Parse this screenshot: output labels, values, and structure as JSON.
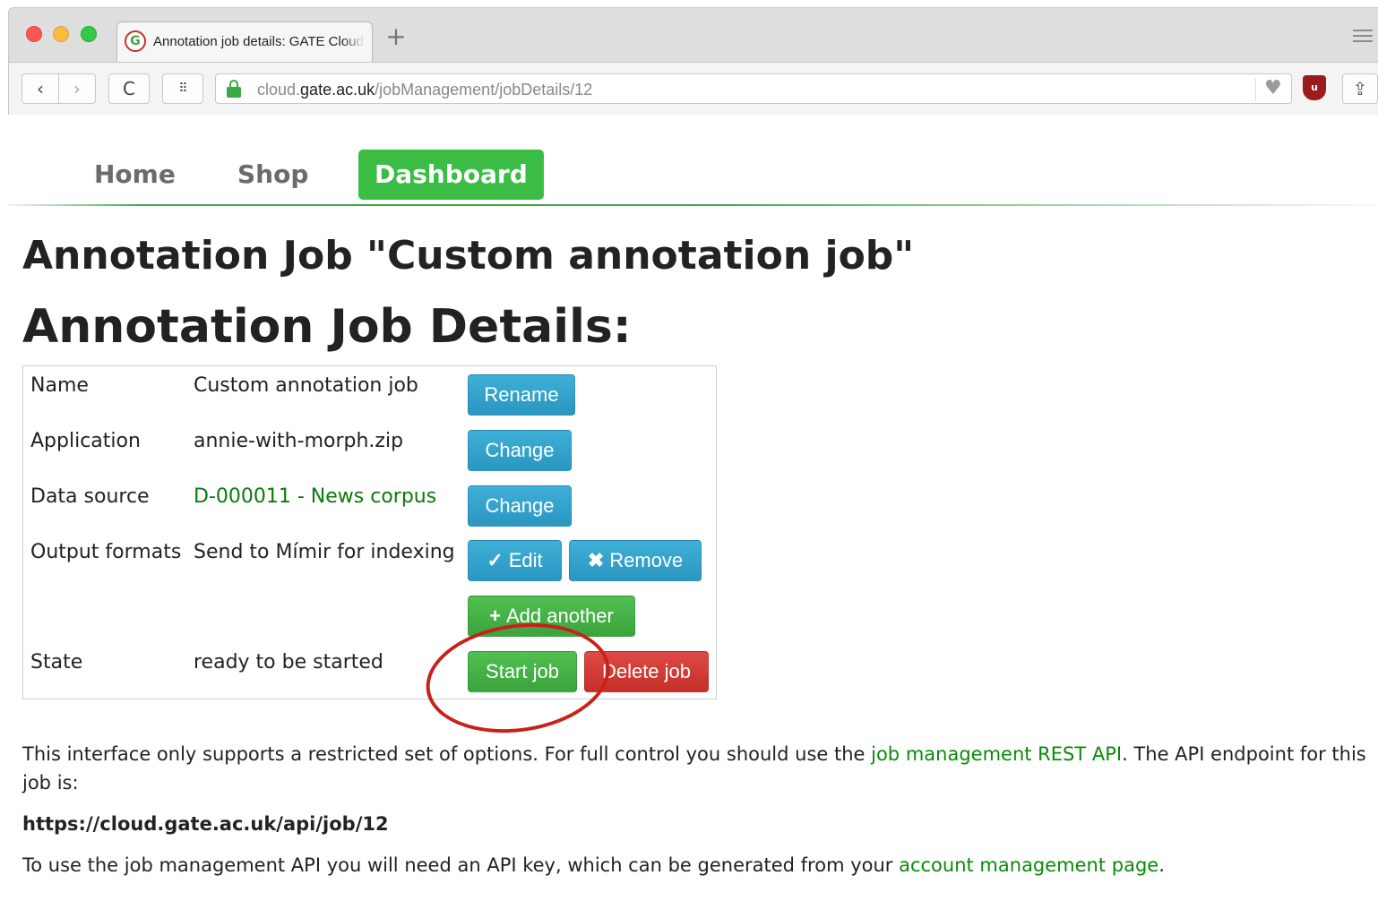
{
  "browser": {
    "tab_title": "Annotation job details: GATE Cloud",
    "favicon": "G",
    "new_tab": "+",
    "url_prefix": "cloud.",
    "url_domain": "gate.ac.uk",
    "url_path": "/jobManagement/jobDetails/12",
    "icons": {
      "back": "‹",
      "forward": "›",
      "reload": "C",
      "grid": "⠿",
      "heart": "♥",
      "extension": "u",
      "share": "⇪"
    }
  },
  "nav": {
    "home": "Home",
    "shop": "Shop",
    "dashboard": "Dashboard",
    "active": "Dashboard",
    "accent_color": "#3bbd45"
  },
  "page": {
    "title": "Annotation Job \"Custom annotation job\"",
    "subtitle": "Annotation Job Details:"
  },
  "details": {
    "name_label": "Name",
    "name_value": "Custom annotation job",
    "rename_button": "Rename",
    "application_label": "Application",
    "application_value": "annie-with-morph.zip",
    "application_change": "Change",
    "datasource_label": "Data source",
    "datasource_value": "D-000011 - News corpus",
    "datasource_change": "Change",
    "output_label": "Output formats",
    "output_value": "Send to Mímir for indexing",
    "edit_button": "Edit",
    "remove_button": "Remove",
    "add_another_button": "Add another",
    "state_label": "State",
    "state_value": "ready to be started",
    "start_button": "Start job",
    "delete_button": "Delete job"
  },
  "info": {
    "p1_text": "This interface only supports a restricted set of options. For full control you should use the ",
    "p1_link": "job management REST API",
    "p1_tail": ". The API endpoint for this job is:",
    "endpoint": "https://cloud.gate.ac.uk/api/job/12",
    "p3_text": "To use the job management API you will need an API key, which can be generated from your ",
    "p3_link": "account management page",
    "p3_tail": "."
  }
}
